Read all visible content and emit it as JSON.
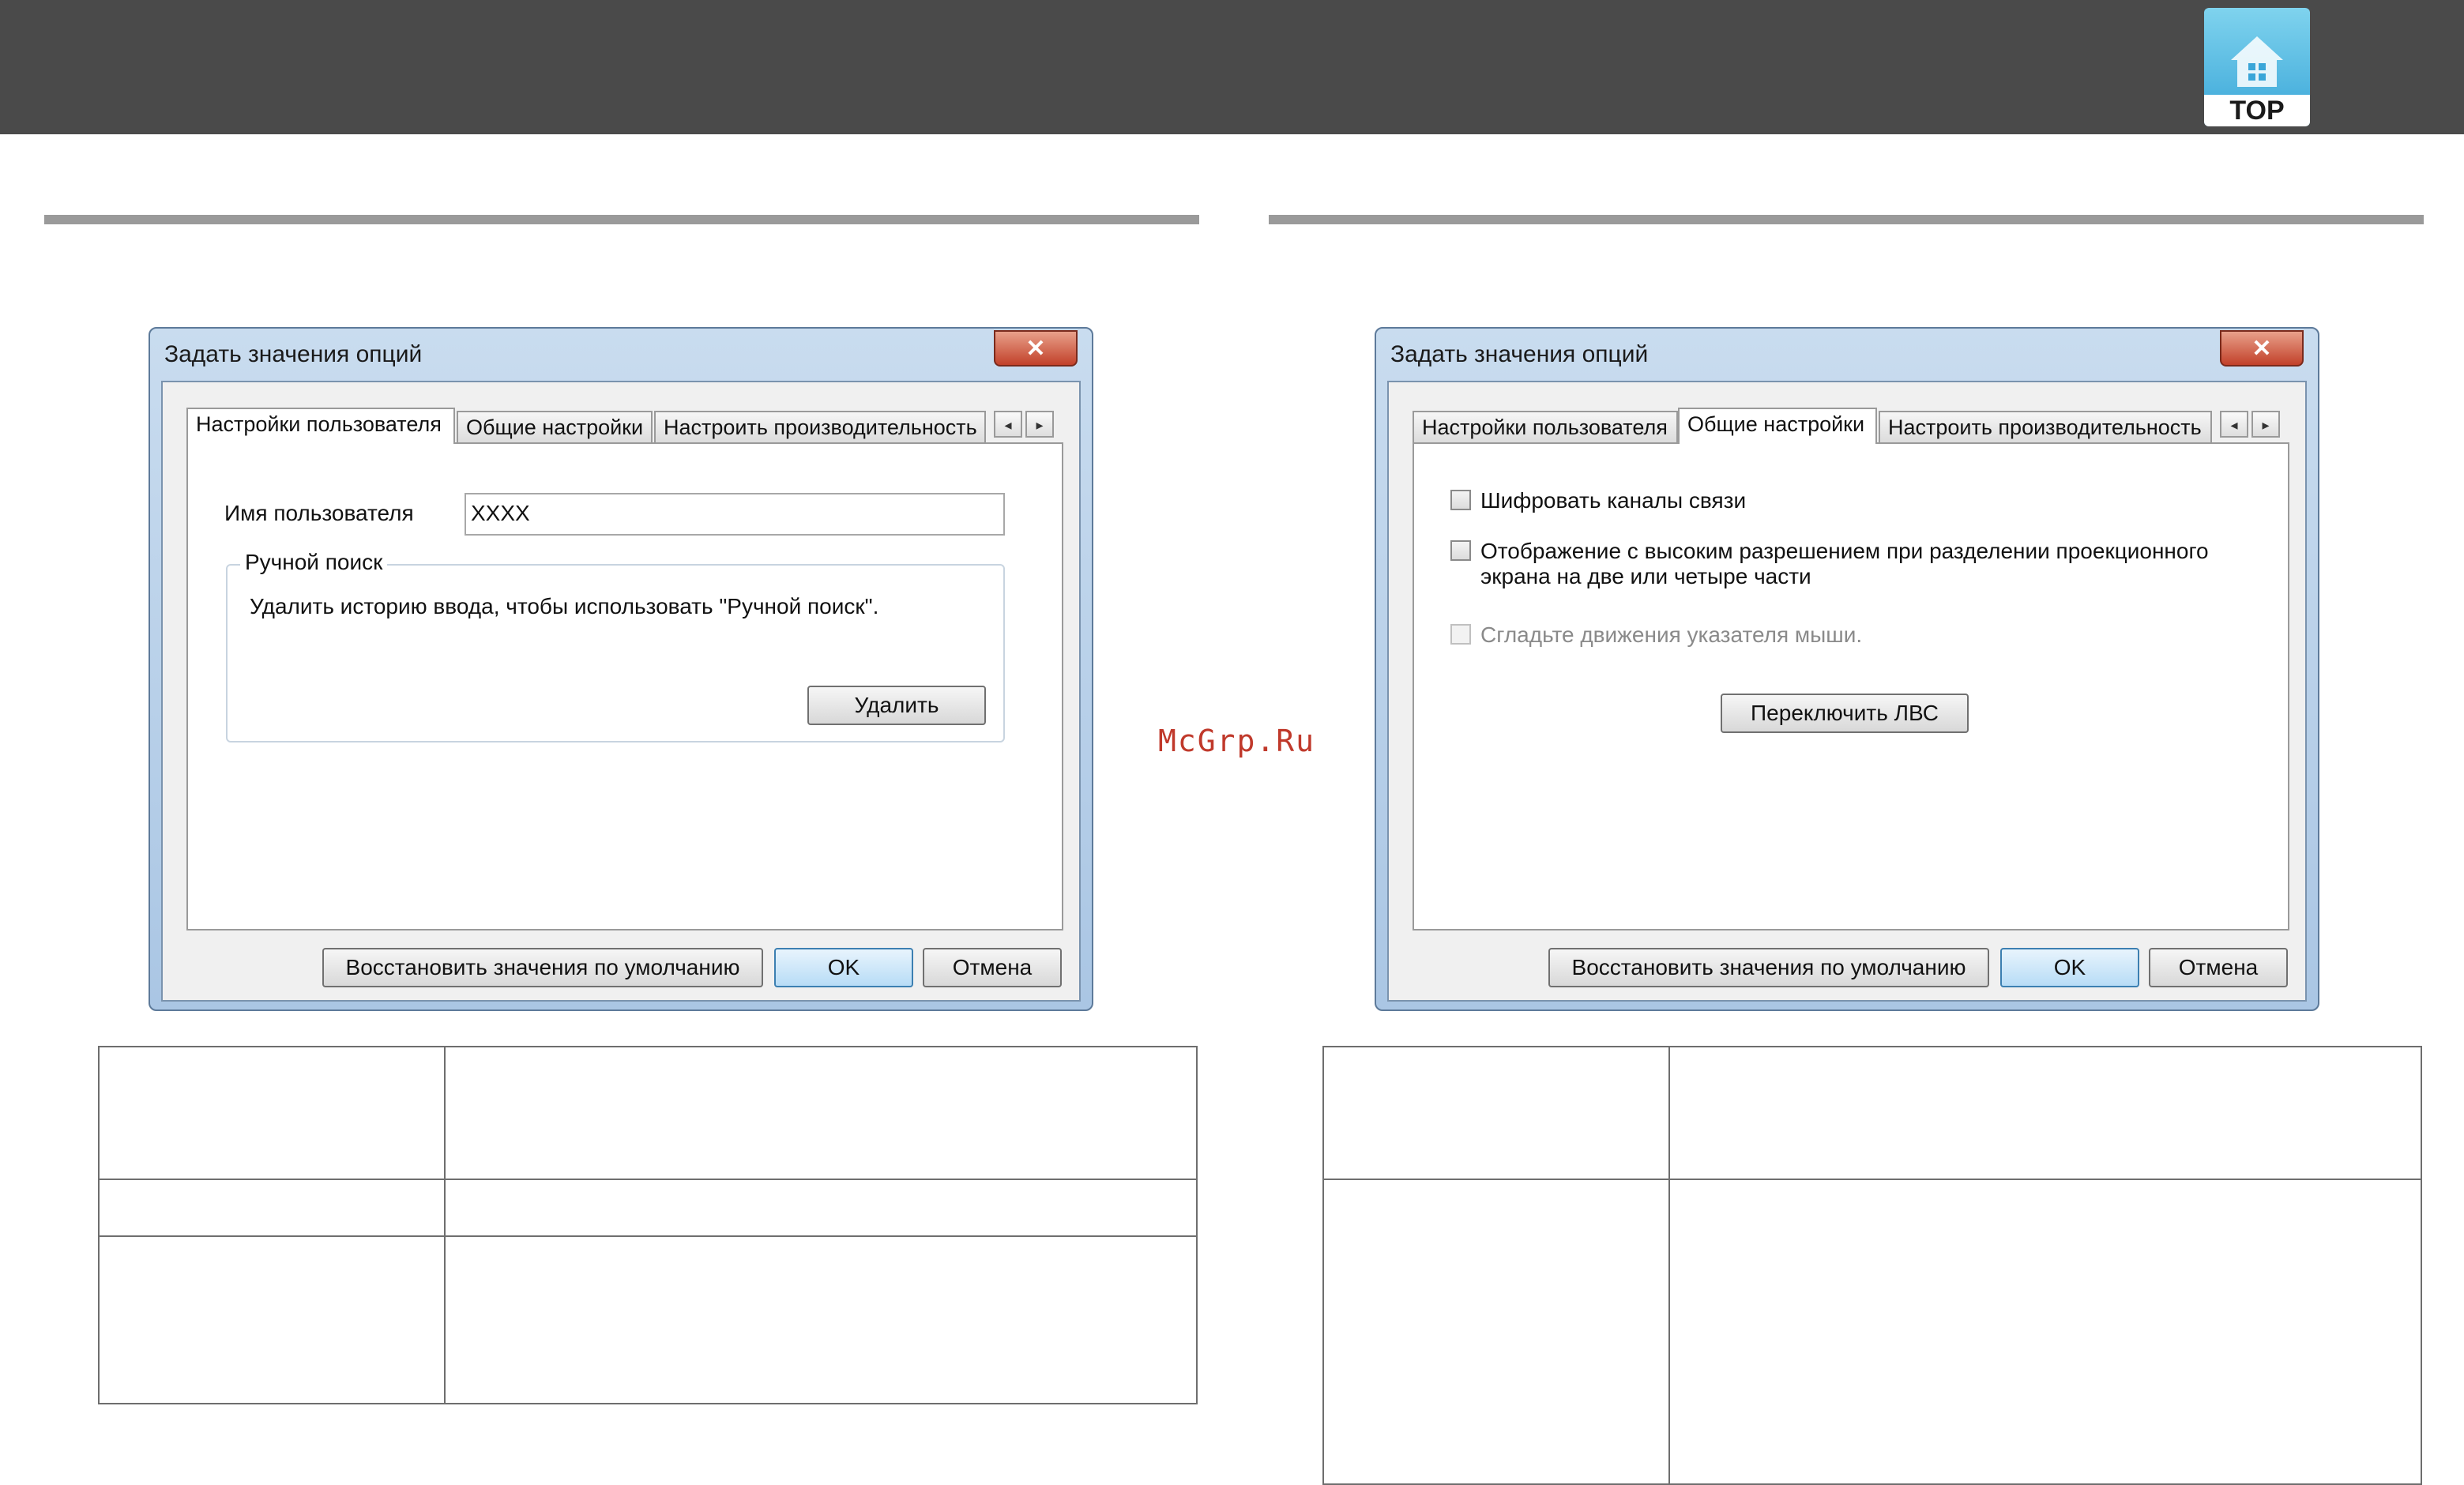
{
  "header": {
    "top_label": "TOP"
  },
  "watermark": "McGrp.Ru",
  "left_dialog": {
    "title": "Задать значения опций",
    "close_glyph": "✕",
    "tabs": [
      {
        "label": "Настройки пользователя",
        "active": true
      },
      {
        "label": "Общие настройки",
        "active": false
      },
      {
        "label": "Настроить производительность",
        "active": false
      }
    ],
    "scroll_left": "◂",
    "scroll_right": "▸",
    "user_name_label": "Имя пользователя",
    "user_name_value": "XXXX",
    "manual_search_group": "Ручной поиск",
    "manual_search_text": "Удалить историю ввода, чтобы использовать \"Ручной поиск\".",
    "delete_button": "Удалить",
    "footer": {
      "restore_label": "Восстановить значения по умолчанию",
      "ok_label": "OK",
      "cancel_label": "Отмена"
    }
  },
  "right_dialog": {
    "title": "Задать значения опций",
    "close_glyph": "✕",
    "tabs": [
      {
        "label": "Настройки пользователя",
        "active": false
      },
      {
        "label": "Общие настройки",
        "active": true
      },
      {
        "label": "Настроить производительность",
        "active": false
      }
    ],
    "scroll_left": "◂",
    "scroll_right": "▸",
    "options": [
      {
        "label": "Шифровать каналы связи",
        "checked": false,
        "enabled": true
      },
      {
        "label": "Отображение с высоким разрешением при разделении проекционного",
        "label_line2": "экрана на две или четыре части",
        "checked": false,
        "enabled": true
      },
      {
        "label": "Сгладьте движения указателя мыши.",
        "checked": false,
        "enabled": false
      }
    ],
    "switch_lan_button": "Переключить ЛВС",
    "footer": {
      "restore_label": "Восстановить значения по умолчанию",
      "ok_label": "OK",
      "cancel_label": "Отмена"
    }
  },
  "colors": {
    "header_bar": "#4a4a4a",
    "rule": "#9a9a9a",
    "watermark": "#c0392b",
    "close_button": "#c2412a"
  }
}
